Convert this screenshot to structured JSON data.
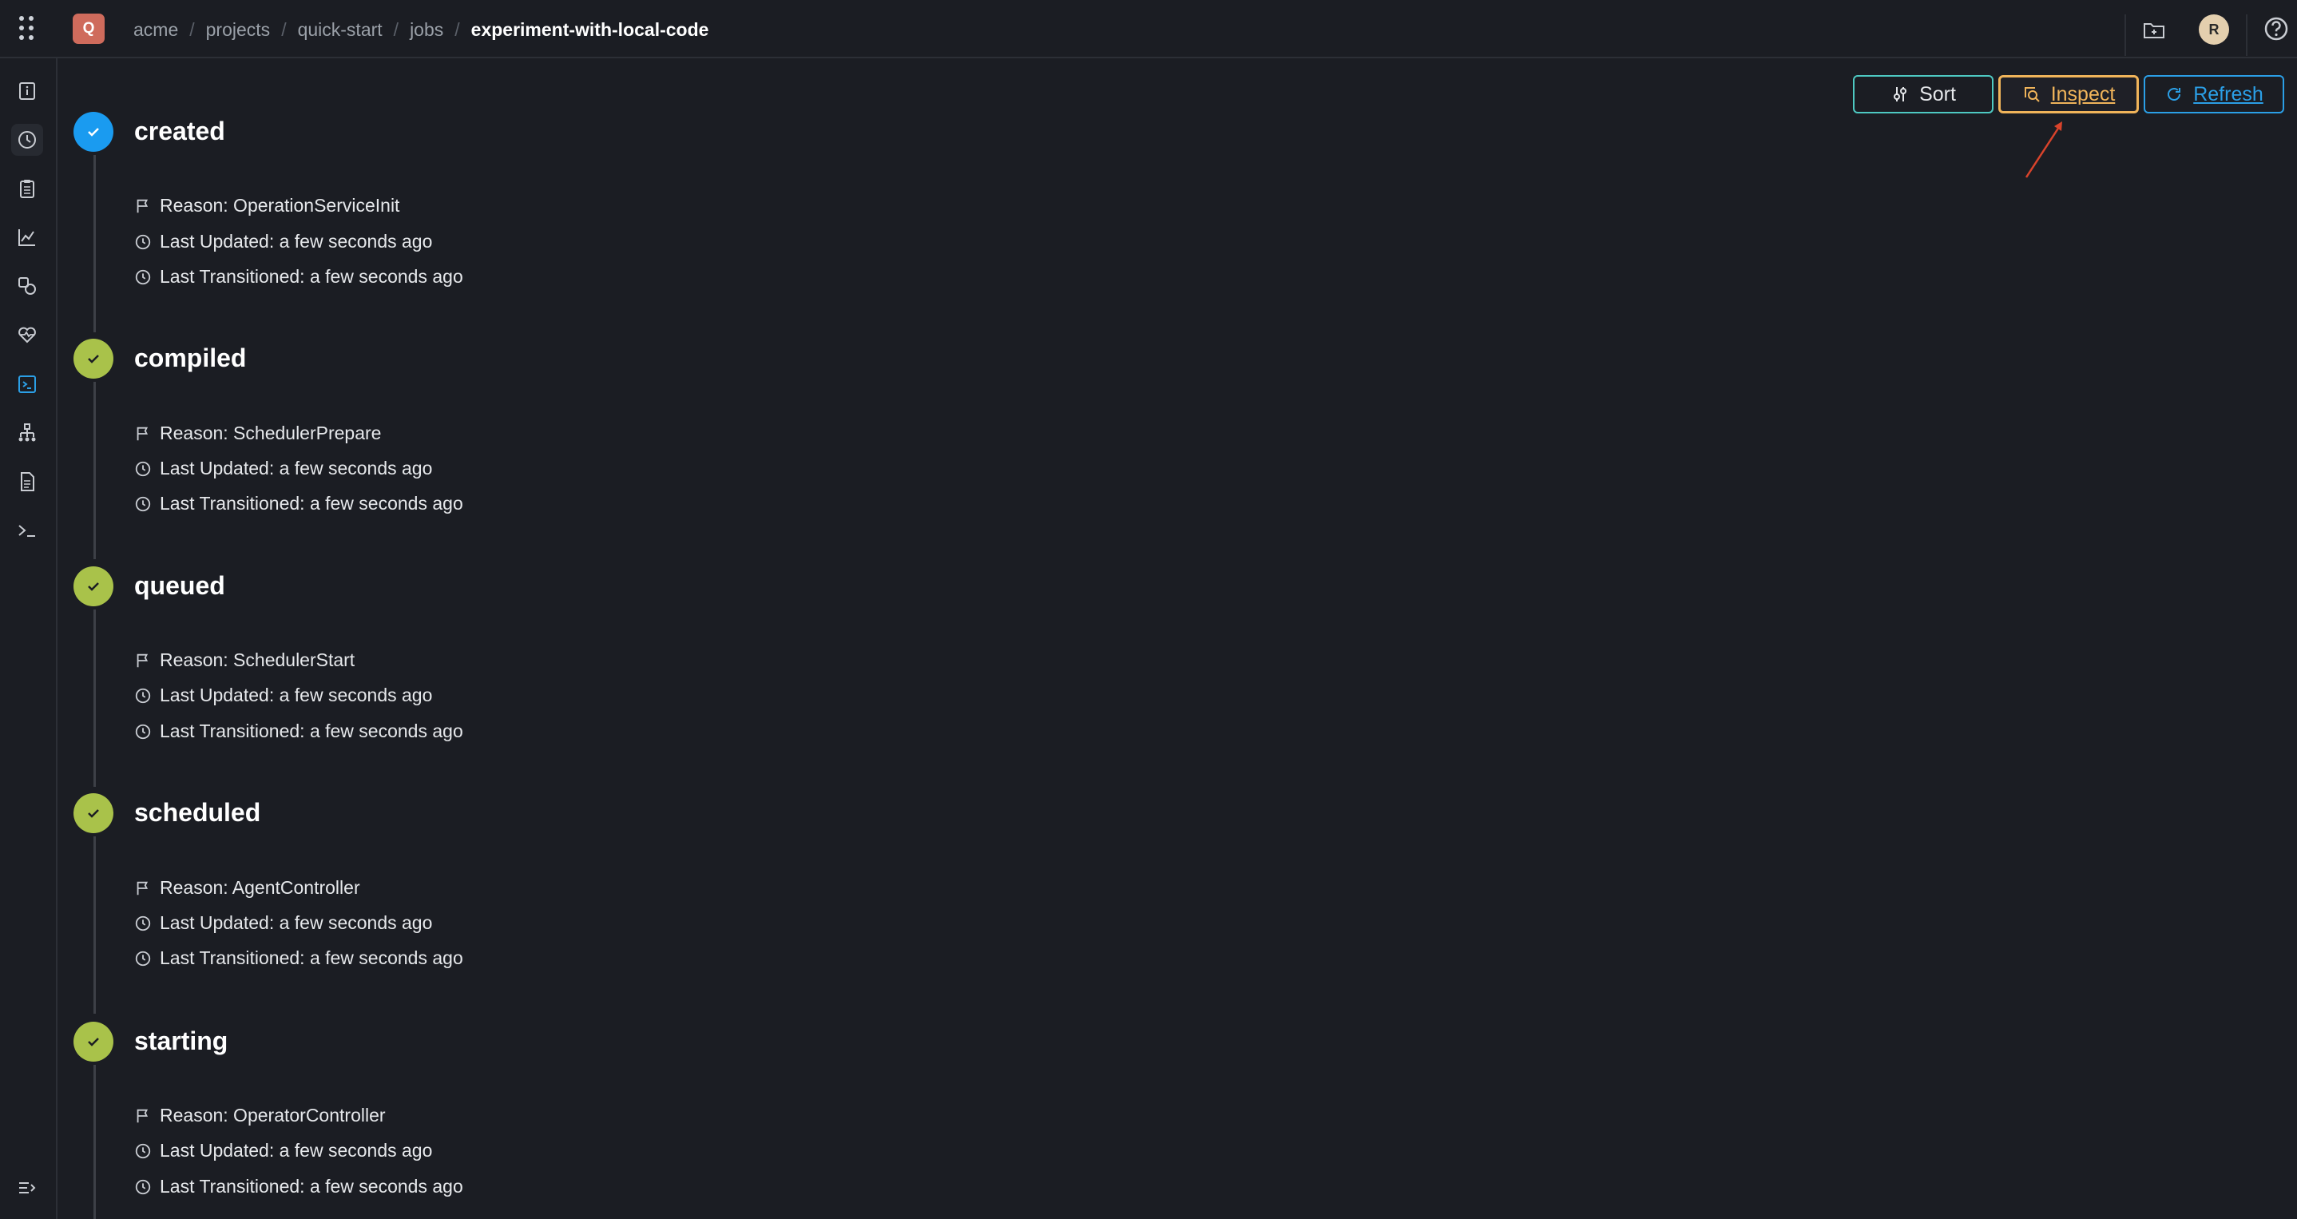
{
  "topbar": {
    "project_initial": "Q",
    "breadcrumb": [
      "acme",
      "projects",
      "quick-start",
      "jobs",
      "experiment-with-local-code"
    ],
    "user_initial": "R"
  },
  "actions": {
    "sort_label": "Sort",
    "inspect_label": "Inspect",
    "refresh_label": "Refresh"
  },
  "colors": {
    "background": "#1b1d23",
    "created_dot": "#1a9bf0",
    "done_dot": "#a9c24a",
    "sort_border": "#4ec9c2",
    "inspect_accent": "#f0b45a",
    "refresh_accent": "#2b9fe6",
    "annotation_arrow": "#d9432b"
  },
  "sidebar": {
    "icons": [
      "info-icon",
      "history-icon",
      "clipboard-icon",
      "chart-icon",
      "shapes-icon",
      "heart-pulse-icon",
      "terminal-square-icon",
      "hierarchy-icon",
      "document-icon",
      "terminal-icon",
      "collapse-menu-icon"
    ]
  },
  "timeline": {
    "stages": [
      {
        "name": "created",
        "reason": "Reason: OperationServiceInit",
        "last_updated": "Last Updated: a few seconds ago",
        "last_transitioned": "Last Transitioned: a few seconds ago"
      },
      {
        "name": "compiled",
        "reason": "Reason: SchedulerPrepare",
        "last_updated": "Last Updated: a few seconds ago",
        "last_transitioned": "Last Transitioned: a few seconds ago"
      },
      {
        "name": "queued",
        "reason": "Reason: SchedulerStart",
        "last_updated": "Last Updated: a few seconds ago",
        "last_transitioned": "Last Transitioned: a few seconds ago"
      },
      {
        "name": "scheduled",
        "reason": "Reason: AgentController",
        "last_updated": "Last Updated: a few seconds ago",
        "last_transitioned": "Last Transitioned: a few seconds ago"
      },
      {
        "name": "starting",
        "reason": "Reason: OperatorController",
        "last_updated": "Last Updated: a few seconds ago",
        "last_transitioned": "Last Transitioned: a few seconds ago"
      }
    ]
  }
}
